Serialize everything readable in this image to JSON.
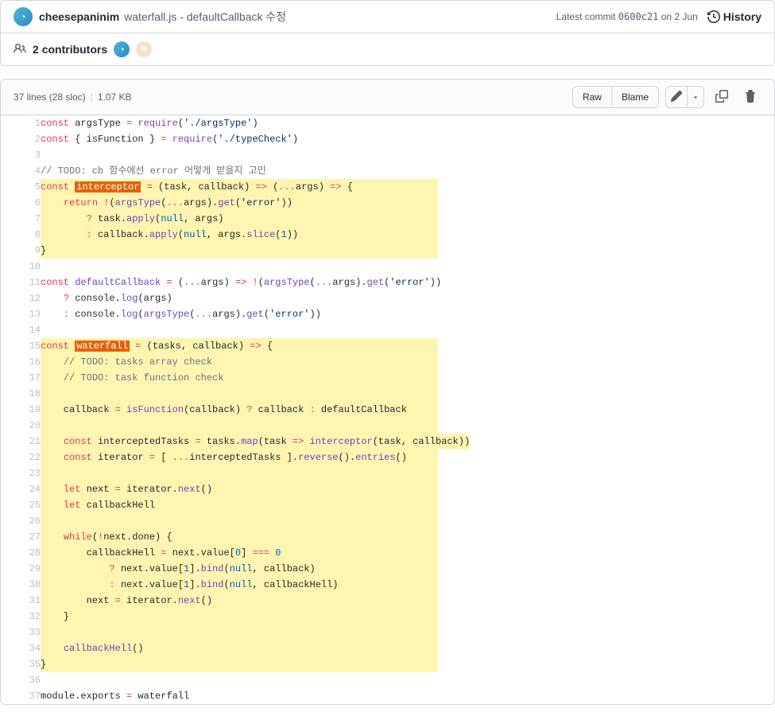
{
  "commit": {
    "author": "cheesepaninim",
    "message": "waterfall.js - defaultCallback 수정",
    "latest_label": "Latest commit",
    "sha": "0600c21",
    "date": "on 2 Jun",
    "history_label": "History"
  },
  "contributors": {
    "count": "2",
    "label": "contributors"
  },
  "file_header": {
    "lines": "37 lines (28 sloc)",
    "size": "1.07 KB",
    "raw": "Raw",
    "blame": "Blame"
  },
  "code_lines": [
    {
      "n": 1,
      "hl": false,
      "tokens": [
        [
          "k",
          "const"
        ],
        [
          "v",
          " argsType "
        ],
        [
          "o",
          "="
        ],
        [
          "v",
          " "
        ],
        [
          "fn",
          "require"
        ],
        [
          "v",
          "("
        ],
        [
          "s",
          "'./argsType'"
        ],
        [
          "v",
          ")"
        ]
      ]
    },
    {
      "n": 2,
      "hl": false,
      "tokens": [
        [
          "k",
          "const"
        ],
        [
          "v",
          " { isFunction } "
        ],
        [
          "o",
          "="
        ],
        [
          "v",
          " "
        ],
        [
          "fn",
          "require"
        ],
        [
          "v",
          "("
        ],
        [
          "s",
          "'./typeCheck'"
        ],
        [
          "v",
          ")"
        ]
      ]
    },
    {
      "n": 3,
      "hl": false,
      "tokens": []
    },
    {
      "n": 4,
      "hl": false,
      "tokens": [
        [
          "c",
          "// TODO: cb 함수에선 error 어떻게 받을지 고민"
        ]
      ]
    },
    {
      "n": 5,
      "hl": true,
      "tokens": [
        [
          "k",
          "const"
        ],
        [
          "v",
          " "
        ],
        [
          "mark",
          "interceptor"
        ],
        [
          "v",
          " "
        ],
        [
          "o",
          "="
        ],
        [
          "v",
          " (task, callback) "
        ],
        [
          "o",
          "=>"
        ],
        [
          "v",
          " ("
        ],
        [
          "o",
          "..."
        ],
        [
          "v",
          "args) "
        ],
        [
          "o",
          "=>"
        ],
        [
          "v",
          " {"
        ]
      ]
    },
    {
      "n": 6,
      "hl": true,
      "tokens": [
        [
          "v",
          "    "
        ],
        [
          "k",
          "return"
        ],
        [
          "v",
          " "
        ],
        [
          "o",
          "!"
        ],
        [
          "v",
          "("
        ],
        [
          "fn",
          "argsType"
        ],
        [
          "v",
          "("
        ],
        [
          "o",
          "..."
        ],
        [
          "v",
          "args)."
        ],
        [
          "fn",
          "get"
        ],
        [
          "v",
          "("
        ],
        [
          "s",
          "'error'"
        ],
        [
          "v",
          "))"
        ]
      ]
    },
    {
      "n": 7,
      "hl": true,
      "tokens": [
        [
          "v",
          "        "
        ],
        [
          "o",
          "?"
        ],
        [
          "v",
          " task."
        ],
        [
          "fn",
          "apply"
        ],
        [
          "v",
          "("
        ],
        [
          "n",
          "null"
        ],
        [
          "v",
          ", args)"
        ]
      ]
    },
    {
      "n": 8,
      "hl": true,
      "tokens": [
        [
          "v",
          "        "
        ],
        [
          "o",
          ":"
        ],
        [
          "v",
          " callback."
        ],
        [
          "fn",
          "apply"
        ],
        [
          "v",
          "("
        ],
        [
          "n",
          "null"
        ],
        [
          "v",
          ", args."
        ],
        [
          "fn",
          "slice"
        ],
        [
          "v",
          "("
        ],
        [
          "n",
          "1"
        ],
        [
          "v",
          "))"
        ]
      ]
    },
    {
      "n": 9,
      "hl": true,
      "tokens": [
        [
          "v",
          "}"
        ]
      ]
    },
    {
      "n": 10,
      "hl": false,
      "tokens": []
    },
    {
      "n": 11,
      "hl": false,
      "tokens": [
        [
          "k",
          "const"
        ],
        [
          "v",
          " "
        ],
        [
          "fn",
          "defaultCallback"
        ],
        [
          "v",
          " "
        ],
        [
          "o",
          "="
        ],
        [
          "v",
          " ("
        ],
        [
          "o",
          "..."
        ],
        [
          "v",
          "args) "
        ],
        [
          "o",
          "=>"
        ],
        [
          "v",
          " "
        ],
        [
          "o",
          "!"
        ],
        [
          "v",
          "("
        ],
        [
          "fn",
          "argsType"
        ],
        [
          "v",
          "("
        ],
        [
          "o",
          "..."
        ],
        [
          "v",
          "args)."
        ],
        [
          "fn",
          "get"
        ],
        [
          "v",
          "("
        ],
        [
          "s",
          "'error'"
        ],
        [
          "v",
          "))"
        ]
      ]
    },
    {
      "n": 12,
      "hl": false,
      "tokens": [
        [
          "v",
          "    "
        ],
        [
          "o",
          "?"
        ],
        [
          "v",
          " console."
        ],
        [
          "fn",
          "log"
        ],
        [
          "v",
          "(args)"
        ]
      ]
    },
    {
      "n": 13,
      "hl": false,
      "tokens": [
        [
          "v",
          "    "
        ],
        [
          "o",
          ":"
        ],
        [
          "v",
          " console."
        ],
        [
          "fn",
          "log"
        ],
        [
          "v",
          "("
        ],
        [
          "fn",
          "argsType"
        ],
        [
          "v",
          "("
        ],
        [
          "o",
          "..."
        ],
        [
          "v",
          "args)."
        ],
        [
          "fn",
          "get"
        ],
        [
          "v",
          "("
        ],
        [
          "s",
          "'error'"
        ],
        [
          "v",
          "))"
        ]
      ]
    },
    {
      "n": 14,
      "hl": false,
      "tokens": []
    },
    {
      "n": 15,
      "hl": true,
      "tokens": [
        [
          "k",
          "const"
        ],
        [
          "v",
          " "
        ],
        [
          "mark",
          "waterfall"
        ],
        [
          "v",
          " "
        ],
        [
          "o",
          "="
        ],
        [
          "v",
          " (tasks, callback) "
        ],
        [
          "o",
          "=>"
        ],
        [
          "v",
          " {"
        ]
      ]
    },
    {
      "n": 16,
      "hl": true,
      "tokens": [
        [
          "v",
          "    "
        ],
        [
          "c",
          "// TODO: tasks array check"
        ]
      ]
    },
    {
      "n": 17,
      "hl": true,
      "tokens": [
        [
          "v",
          "    "
        ],
        [
          "c",
          "// TODO: task function check"
        ]
      ]
    },
    {
      "n": 18,
      "hl": true,
      "tokens": []
    },
    {
      "n": 19,
      "hl": true,
      "tokens": [
        [
          "v",
          "    callback "
        ],
        [
          "o",
          "="
        ],
        [
          "v",
          " "
        ],
        [
          "fn",
          "isFunction"
        ],
        [
          "v",
          "(callback) "
        ],
        [
          "o",
          "?"
        ],
        [
          "v",
          " callback "
        ],
        [
          "o",
          ":"
        ],
        [
          "v",
          " defaultCallback"
        ]
      ]
    },
    {
      "n": 20,
      "hl": true,
      "tokens": []
    },
    {
      "n": 21,
      "hl": true,
      "tokens": [
        [
          "v",
          "    "
        ],
        [
          "k",
          "const"
        ],
        [
          "v",
          " interceptedTasks "
        ],
        [
          "o",
          "="
        ],
        [
          "v",
          " tasks."
        ],
        [
          "fn",
          "map"
        ],
        [
          "v",
          "(task "
        ],
        [
          "o",
          "=>"
        ],
        [
          "v",
          " "
        ],
        [
          "fn",
          "interceptor"
        ],
        [
          "v",
          "(task, callback))"
        ]
      ]
    },
    {
      "n": 22,
      "hl": true,
      "tokens": [
        [
          "v",
          "    "
        ],
        [
          "k",
          "const"
        ],
        [
          "v",
          " iterator "
        ],
        [
          "o",
          "="
        ],
        [
          "v",
          " [ "
        ],
        [
          "o",
          "..."
        ],
        [
          "v",
          "interceptedTasks ]."
        ],
        [
          "fn",
          "reverse"
        ],
        [
          "v",
          "()."
        ],
        [
          "fn",
          "entries"
        ],
        [
          "v",
          "()"
        ]
      ]
    },
    {
      "n": 23,
      "hl": true,
      "tokens": []
    },
    {
      "n": 24,
      "hl": true,
      "tokens": [
        [
          "v",
          "    "
        ],
        [
          "k",
          "let"
        ],
        [
          "v",
          " next "
        ],
        [
          "o",
          "="
        ],
        [
          "v",
          " iterator."
        ],
        [
          "fn",
          "next"
        ],
        [
          "v",
          "()"
        ]
      ]
    },
    {
      "n": 25,
      "hl": true,
      "tokens": [
        [
          "v",
          "    "
        ],
        [
          "k",
          "let"
        ],
        [
          "v",
          " callbackHell"
        ]
      ]
    },
    {
      "n": 26,
      "hl": true,
      "tokens": []
    },
    {
      "n": 27,
      "hl": true,
      "tokens": [
        [
          "v",
          "    "
        ],
        [
          "k",
          "while"
        ],
        [
          "v",
          "("
        ],
        [
          "o",
          "!"
        ],
        [
          "v",
          "next.done) {"
        ]
      ]
    },
    {
      "n": 28,
      "hl": true,
      "tokens": [
        [
          "v",
          "        callbackHell "
        ],
        [
          "o",
          "="
        ],
        [
          "v",
          " next.value["
        ],
        [
          "n",
          "0"
        ],
        [
          "v",
          "] "
        ],
        [
          "o",
          "==="
        ],
        [
          "v",
          " "
        ],
        [
          "n",
          "0"
        ]
      ]
    },
    {
      "n": 29,
      "hl": true,
      "tokens": [
        [
          "v",
          "            "
        ],
        [
          "o",
          "?"
        ],
        [
          "v",
          " next.value["
        ],
        [
          "n",
          "1"
        ],
        [
          "v",
          "]."
        ],
        [
          "fn",
          "bind"
        ],
        [
          "v",
          "("
        ],
        [
          "n",
          "null"
        ],
        [
          "v",
          ", callback)"
        ]
      ]
    },
    {
      "n": 30,
      "hl": true,
      "tokens": [
        [
          "v",
          "            "
        ],
        [
          "o",
          ":"
        ],
        [
          "v",
          " next.value["
        ],
        [
          "n",
          "1"
        ],
        [
          "v",
          "]."
        ],
        [
          "fn",
          "bind"
        ],
        [
          "v",
          "("
        ],
        [
          "n",
          "null"
        ],
        [
          "v",
          ", callbackHell)"
        ]
      ]
    },
    {
      "n": 31,
      "hl": true,
      "tokens": [
        [
          "v",
          "        next "
        ],
        [
          "o",
          "="
        ],
        [
          "v",
          " iterator."
        ],
        [
          "fn",
          "next"
        ],
        [
          "v",
          "()"
        ]
      ]
    },
    {
      "n": 32,
      "hl": true,
      "tokens": [
        [
          "v",
          "    }"
        ]
      ]
    },
    {
      "n": 33,
      "hl": true,
      "tokens": []
    },
    {
      "n": 34,
      "hl": true,
      "tokens": [
        [
          "v",
          "    "
        ],
        [
          "fn",
          "callbackHell"
        ],
        [
          "v",
          "()"
        ]
      ]
    },
    {
      "n": 35,
      "hl": true,
      "tokens": [
        [
          "v",
          "}"
        ]
      ]
    },
    {
      "n": 36,
      "hl": false,
      "tokens": []
    },
    {
      "n": 37,
      "hl": false,
      "tokens": [
        [
          "v",
          "module.exports "
        ],
        [
          "o",
          "="
        ],
        [
          "v",
          " waterfall"
        ]
      ]
    }
  ]
}
